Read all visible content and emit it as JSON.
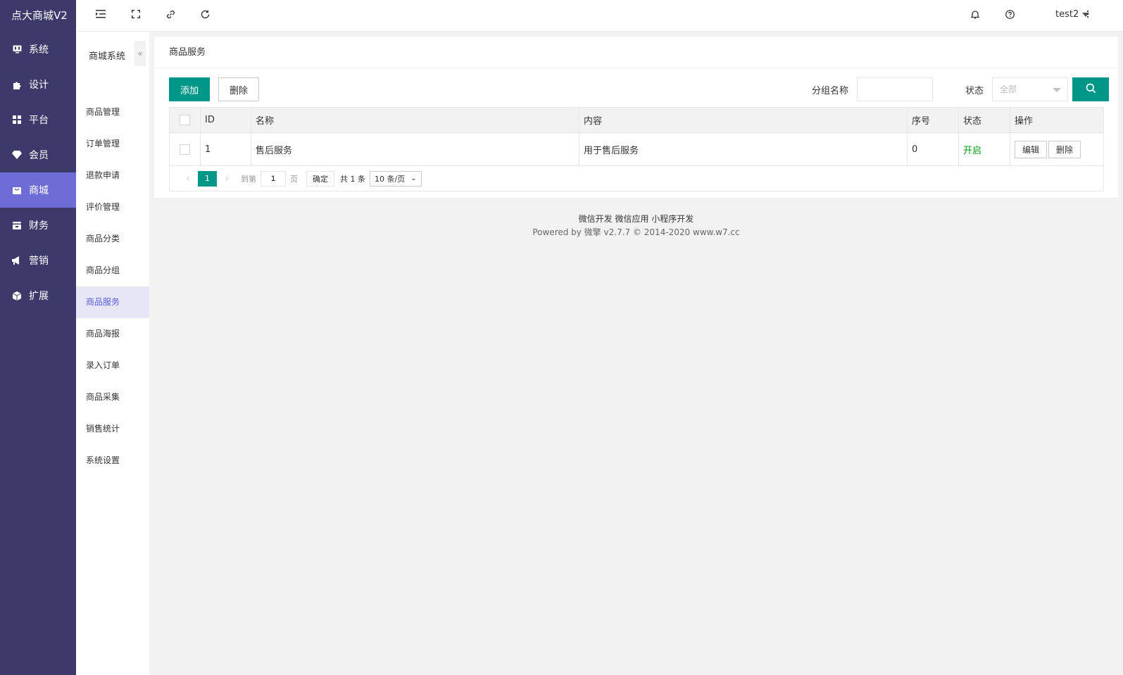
{
  "app": {
    "title": "点大商城V2"
  },
  "nav": {
    "items": [
      {
        "label": "系统",
        "icon": "monitor-icon"
      },
      {
        "label": "设计",
        "icon": "puzzle-icon"
      },
      {
        "label": "平台",
        "icon": "grid-icon"
      },
      {
        "label": "会员",
        "icon": "diamond-icon"
      },
      {
        "label": "商城",
        "icon": "store-icon",
        "active": true
      },
      {
        "label": "财务",
        "icon": "wallet-icon"
      },
      {
        "label": "营销",
        "icon": "megaphone-icon"
      },
      {
        "label": "扩展",
        "icon": "cube-icon"
      }
    ]
  },
  "header": {
    "user": "test2"
  },
  "subnav": {
    "title": "商城系统",
    "items": [
      {
        "label": "商品管理"
      },
      {
        "label": "订单管理"
      },
      {
        "label": "退款申请"
      },
      {
        "label": "评价管理"
      },
      {
        "label": "商品分类"
      },
      {
        "label": "商品分组"
      },
      {
        "label": "商品服务",
        "active": true
      },
      {
        "label": "商品海报"
      },
      {
        "label": "录入订单"
      },
      {
        "label": "商品采集"
      },
      {
        "label": "销售统计"
      },
      {
        "label": "系统设置"
      }
    ]
  },
  "page": {
    "title": "商品服务"
  },
  "toolbar": {
    "add_label": "添加",
    "delete_label": "删除",
    "group_label": "分组名称",
    "group_value": "",
    "status_label": "状态",
    "status_selected": "全部"
  },
  "table": {
    "headers": [
      "ID",
      "名称",
      "内容",
      "序号",
      "状态",
      "操作"
    ],
    "rows": [
      {
        "id": "1",
        "name": "售后服务",
        "content": "用于售后服务",
        "order": "0",
        "status": "开启",
        "edit": "编辑",
        "delete": "删除"
      }
    ]
  },
  "pager": {
    "current": "1",
    "goto": "到第",
    "goto_value": "1",
    "page_unit": "页",
    "confirm": "确定",
    "total": "共 1 条",
    "page_size": "10 条/页"
  },
  "footer": {
    "line1": "微信开发 微信应用 小程序开发",
    "line2": "Powered by 微擎 v2.7.7 © 2014-2020 www.w7.cc"
  },
  "colors": {
    "sidebar": "#3b3a6b",
    "active_nav": "#6e6dd6",
    "primary": "#009688",
    "status_on": "#0a9b12"
  }
}
